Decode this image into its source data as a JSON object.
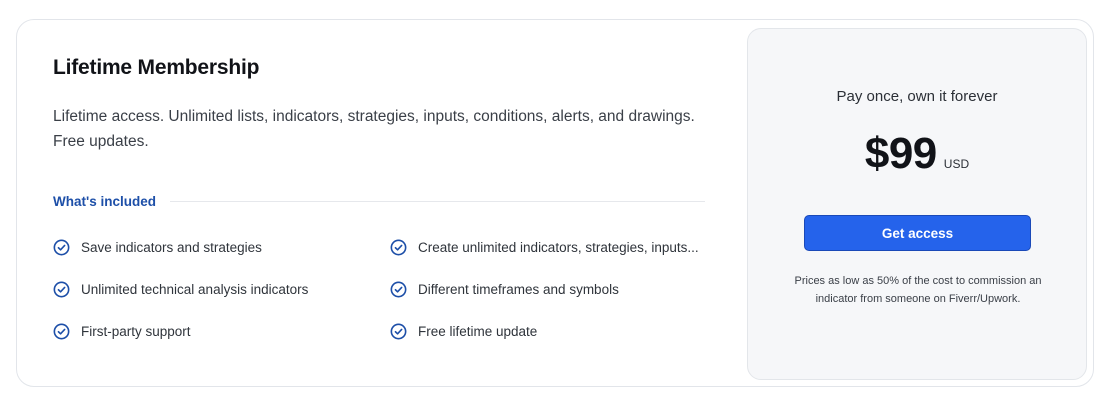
{
  "membership": {
    "title": "Lifetime Membership",
    "description": "Lifetime access. Unlimited lists, indicators, strategies, inputs, conditions, alerts, and drawings. Free updates.",
    "included_label": "What's included",
    "features": [
      "Save indicators and strategies",
      "Create unlimited indicators, strategies, inputs...",
      "Unlimited technical analysis indicators",
      "Different timeframes and symbols",
      "First-party support",
      "Free lifetime update"
    ]
  },
  "pricing": {
    "tagline": "Pay once, own it forever",
    "price": "$99",
    "currency": "USD",
    "cta_label": "Get access",
    "note": "Prices as low as 50% of the cost to commission an indicator from someone on Fiverr/Upwork."
  },
  "icons": {
    "feature_icon": "check-circle-icon"
  },
  "colors": {
    "accent": "#2563eb",
    "link": "#1d4fa8",
    "check": "#1d4fa8",
    "panel_bg": "#f6f7f9"
  }
}
